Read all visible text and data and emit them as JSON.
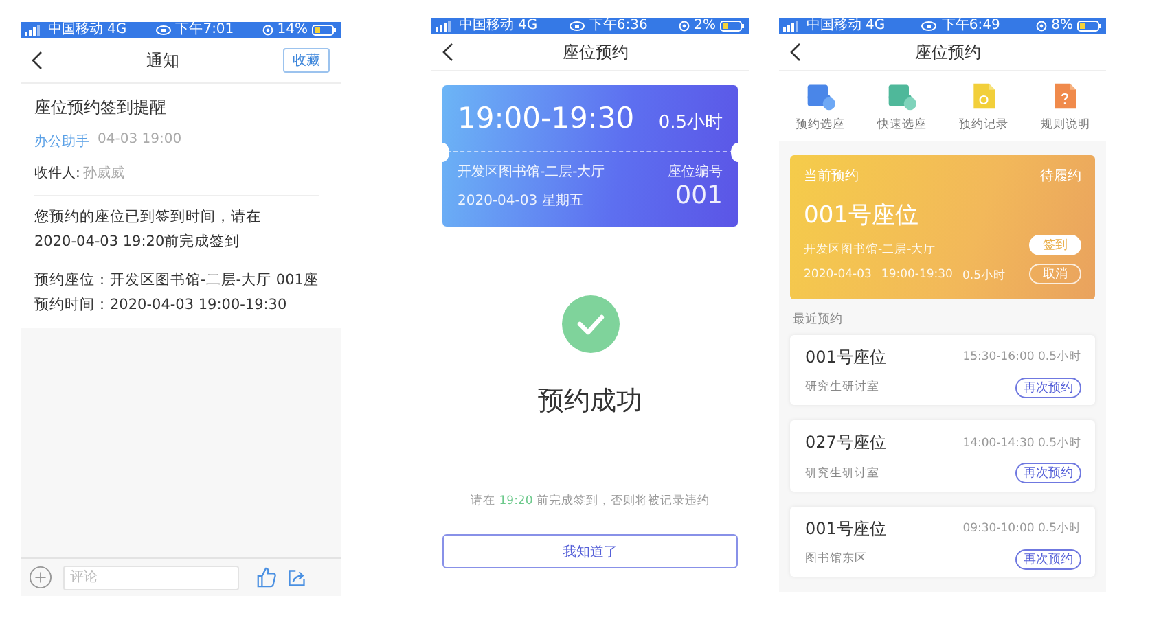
{
  "notice_screen": {
    "status_bar": {
      "carrier": "中国移动",
      "network": "4G",
      "time": "下午7:01",
      "battery": "14%"
    },
    "nav": {
      "title": "通知",
      "action": "收藏"
    },
    "title": "座位预约签到提醒",
    "sender": "办公助手",
    "sent_time": "04-03 19:00",
    "recipient_label": "收件人:",
    "recipient": "孙威威",
    "body": [
      "您预约的座位已到签到时间，请在2020-04-03 19:20前完成签到",
      "预约座位：开发区图书馆-二层-大厅 001座",
      "预约时间：2020-04-03 19:00-19:30"
    ],
    "comment_placeholder": "评论"
  },
  "success_screen": {
    "status_bar": {
      "carrier": "中国移动",
      "network": "4G",
      "time": "下午6:36",
      "battery": "2%"
    },
    "nav": {
      "title": "座位预约"
    },
    "ticket": {
      "time_range": "19:00-19:30",
      "duration": "0.5小时",
      "place": "开发区图书馆-二层-大厅",
      "date": "2020-04-03 星期五",
      "seat_label": "座位编号",
      "seat_number": "001"
    },
    "result": "预约成功",
    "hint": {
      "before": "请在 ",
      "time": "19:20",
      "after": " 前完成签到，否则将被记录违约"
    },
    "confirm": "我知道了"
  },
  "booking_screen": {
    "status_bar": {
      "carrier": "中国移动",
      "network": "4G",
      "time": "下午6:49",
      "battery": "8%"
    },
    "nav": {
      "title": "座位预约"
    },
    "actions": [
      {
        "kind": "book",
        "label": "预约选座"
      },
      {
        "kind": "quick",
        "label": "快速选座"
      },
      {
        "kind": "history",
        "label": "预约记录"
      },
      {
        "kind": "rules",
        "label": "规则说明"
      }
    ],
    "current": {
      "label": "当前预约",
      "status": "待履约",
      "seat": "001号座位",
      "place": "开发区图书馆-二层-大厅",
      "date": "2020-04-03",
      "time_range": "19:00-19:30",
      "duration": "0.5小时",
      "checkin": "签到",
      "cancel": "取消"
    },
    "recent_label": "最近预约",
    "recent": [
      {
        "seat": "001号座位",
        "time_range": "15:30-16:00",
        "duration": "0.5小时",
        "place": "研究生研讨室",
        "action": "再次预约"
      },
      {
        "seat": "027号座位",
        "time_range": "14:00-14:30",
        "duration": "0.5小时",
        "place": "研究生研讨室",
        "action": "再次预约"
      },
      {
        "seat": "001号座位",
        "time_range": "09:30-10:00",
        "duration": "0.5小时",
        "place": "图书馆东区",
        "action": "再次预约"
      }
    ]
  }
}
